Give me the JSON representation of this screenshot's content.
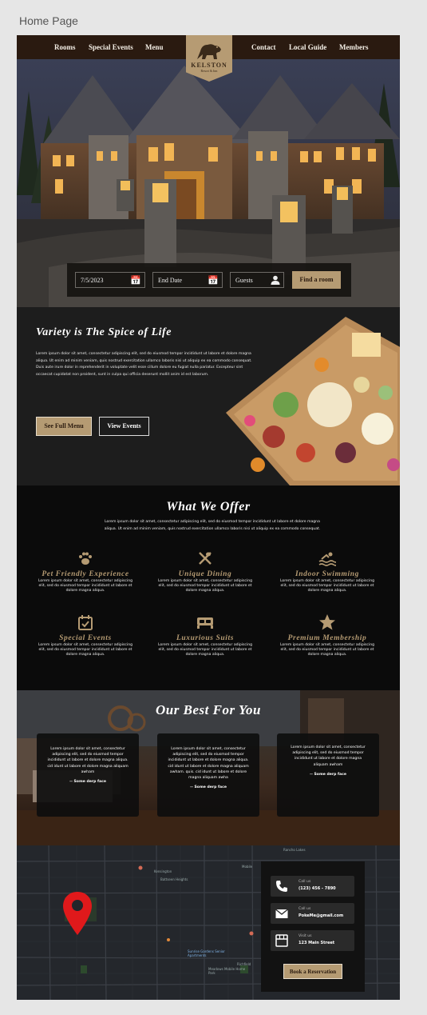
{
  "canvas": {
    "label": "Home Page"
  },
  "nav": {
    "left": [
      "Rooms",
      "Special Events",
      "Menu"
    ],
    "right": [
      "Contact",
      "Local Guide",
      "Members"
    ],
    "logo": {
      "name": "KELSTON",
      "tagline": "Resort & Inn"
    }
  },
  "booking": {
    "start_date": "7/5/2023",
    "end_date": "End Date",
    "guests": "Guests",
    "find_button": "Find a room"
  },
  "variety": {
    "title": "Variety is The Spice of Life",
    "body": "Lorem ipsum dolor sit amet, consectetur adipiscing elit, sed do eiusmod tempor incididunt ut labore et dolore magna aliqua. Ut enim ad minim veniam, quis nostrud exercitation ullamco laboris nisi ut aliquip ex ea commodo consequat. Duis aute irure dolor in reprehenderit in voluptate velit esse cillum dolore eu fugiat nulla pariatur. Excepteur sint occaecat cupidatat non proident, sunt in culpa qui officia deserunt mollit anim id est laborum.",
    "menu_button": "See Full Menu",
    "events_button": "View Events"
  },
  "offer": {
    "title": "What We Offer",
    "intro": "Lorem ipsum dolor sit amet, consectetur adipiscing elit, sed do eiusmod tempor incididunt ut labore et dolore magna aliqua. Ut enim ad minim veniam, quis nostrud exercitation ullamco laboris nisi ut aliquip ex ea commodo consequat.",
    "services": [
      {
        "title": "Pet Friendly Experience",
        "icon": "paw-icon",
        "desc": "Lorem ipsum dolor sit amet, consectetur adipiscing elit, sed do eiusmod tempor incididunt ut labore et dolore magna aliqua."
      },
      {
        "title": "Unique Dining",
        "icon": "dining-icon",
        "desc": "Lorem ipsum dolor sit amet, consectetur adipiscing elit, sed do eiusmod tempor incididunt ut labore et dolore magna aliqua."
      },
      {
        "title": "Indoor Swimming",
        "icon": "swimming-icon",
        "desc": "Lorem ipsum dolor sit amet, consectetur adipiscing elit, sed do eiusmod tempor incididunt ut labore et dolore magna aliqua."
      },
      {
        "title": "Special Events",
        "icon": "calendar-check-icon",
        "desc": "Lorem ipsum dolor sit amet, consectetur adipiscing elit, sed do eiusmod tempor incididunt ut labore et dolore magna aliqua."
      },
      {
        "title": "Luxurious Suits",
        "icon": "bed-icon",
        "desc": "Lorem ipsum dolor sit amet, consectetur adipiscing elit, sed do eiusmod tempor incididunt ut labore et dolore magna aliqua."
      },
      {
        "title": "Premium Membership",
        "icon": "star-icon",
        "desc": "Lorem ipsum dolor sit amet, consectetur adipiscing elit, sed do eiusmod tempor incididunt ut labore et dolore magna aliqua."
      }
    ]
  },
  "best": {
    "title": "Our Best For You",
    "cards": [
      {
        "quote": "Lorem ipsum dolor sit amet, consectetur adipiscing elit, sed do eiusmod tempor incididunt ut labore et dolore magna aliqua. cid idunt ut labore et dolore magna aliquam awham",
        "author": "-- Some derp face"
      },
      {
        "quote": "Lorem ipsum dolor sit amet, consectetur adipiscing elit, sed do eiusmod tempor incididunt ut labore et dolore magna aliqua. cid idunt ut labore et dolore magna aliquam awham. quis. cid idunt ut labore et dolore magna aliquam awha",
        "author": "-- Some derp face"
      },
      {
        "quote": "Lorem ipsum dolor sit amet, consectetur adipiscing elit, sed do eiusmod tempor incididunt ut labore et dolore magna aliquam awham",
        "author": "-- Some derp face"
      }
    ]
  },
  "map": {
    "labels": [
      "Kensington",
      "Battseen Heights",
      "Sunrise Gardens Senior Apartments",
      "Meadows Mobile Home Park",
      "Richfield",
      "Rancho Lakes",
      "Mobile"
    ],
    "call_label": "Call us",
    "call_value": "(123) 456 - 7890",
    "email_label": "Call us",
    "email_value": "PokeMe@gmail.com",
    "visit_label": "Visit us",
    "visit_value": "123 Main Street",
    "reserve_button": "Book a Reservation"
  },
  "colors": {
    "accent": "#b59b73",
    "nav_bg": "#2a1a10",
    "pin": "#e0191b"
  }
}
